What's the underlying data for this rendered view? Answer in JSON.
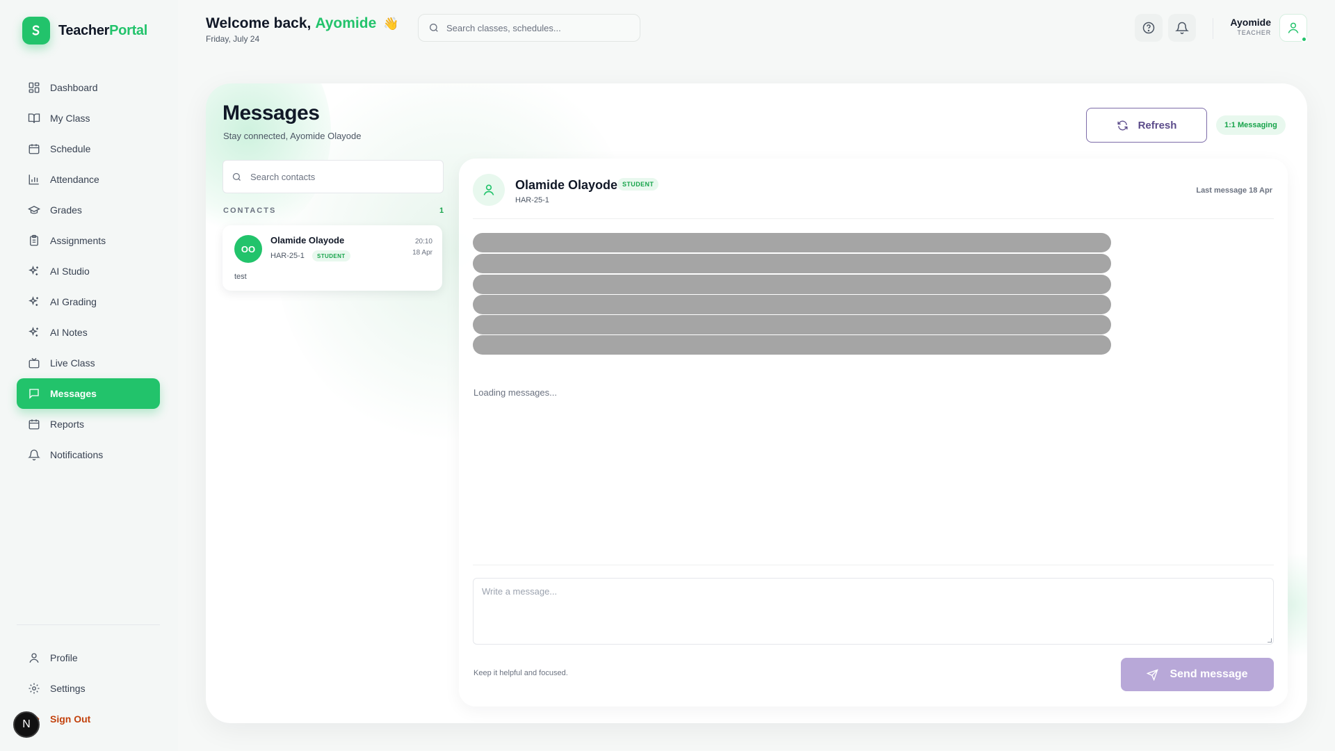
{
  "brand": {
    "name_main": "Teacher",
    "name_accent": "Portal"
  },
  "header": {
    "welcome_prefix": "Welcome back,",
    "user_first_name": "Ayomide",
    "wave": "👋",
    "date": "Friday, July 24",
    "search_placeholder": "Search classes, schedules...",
    "user_name": "Ayomide",
    "user_role": "TEACHER"
  },
  "sidebar": {
    "items": [
      {
        "label": "Dashboard",
        "icon": "dashboard-icon"
      },
      {
        "label": "My Class",
        "icon": "book-icon"
      },
      {
        "label": "Schedule",
        "icon": "calendar-icon"
      },
      {
        "label": "Attendance",
        "icon": "bar-chart-icon"
      },
      {
        "label": "Grades",
        "icon": "graduation-cap-icon"
      },
      {
        "label": "Assignments",
        "icon": "clipboard-icon"
      },
      {
        "label": "AI Studio",
        "icon": "sparkles-icon"
      },
      {
        "label": "AI Grading",
        "icon": "sparkles-icon"
      },
      {
        "label": "AI Notes",
        "icon": "sparkles-icon"
      },
      {
        "label": "Live Class",
        "icon": "tv-icon"
      },
      {
        "label": "Messages",
        "icon": "message-icon",
        "active": true
      },
      {
        "label": "Reports",
        "icon": "calendar-icon"
      },
      {
        "label": "Notifications",
        "icon": "bell-icon"
      }
    ],
    "bottom": [
      {
        "label": "Profile",
        "icon": "user-icon"
      },
      {
        "label": "Settings",
        "icon": "gear-icon"
      },
      {
        "label": "Sign Out",
        "icon": "logout-icon"
      }
    ],
    "floating_badge": "N"
  },
  "messages": {
    "title": "Messages",
    "subtitle": "Stay connected, Ayomide Olayode",
    "refresh_label": "Refresh",
    "mode_badge": "1:1 Messaging",
    "contact_search_placeholder": "Search contacts",
    "contacts_label": "CONTACTS",
    "contacts_count": "1",
    "contacts": [
      {
        "initials": "OO",
        "name": "Olamide Olayode",
        "class": "HAR-25-1",
        "role": "STUDENT",
        "time": "20:10",
        "date": "18 Apr",
        "preview": "test"
      }
    ],
    "chat": {
      "name": "Olamide Olayode",
      "role": "STUDENT",
      "class": "HAR-25-1",
      "last_message": "Last message 18 Apr",
      "loading_text": "Loading messages...",
      "composer_placeholder": "Write a message...",
      "hint": "Keep it helpful and focused.",
      "send_label": "Send message"
    }
  },
  "colors": {
    "accent": "#22c36b",
    "purple": "#5b4b8a",
    "send_disabled": "#b8a8d8",
    "sign_out": "#c2410c"
  }
}
